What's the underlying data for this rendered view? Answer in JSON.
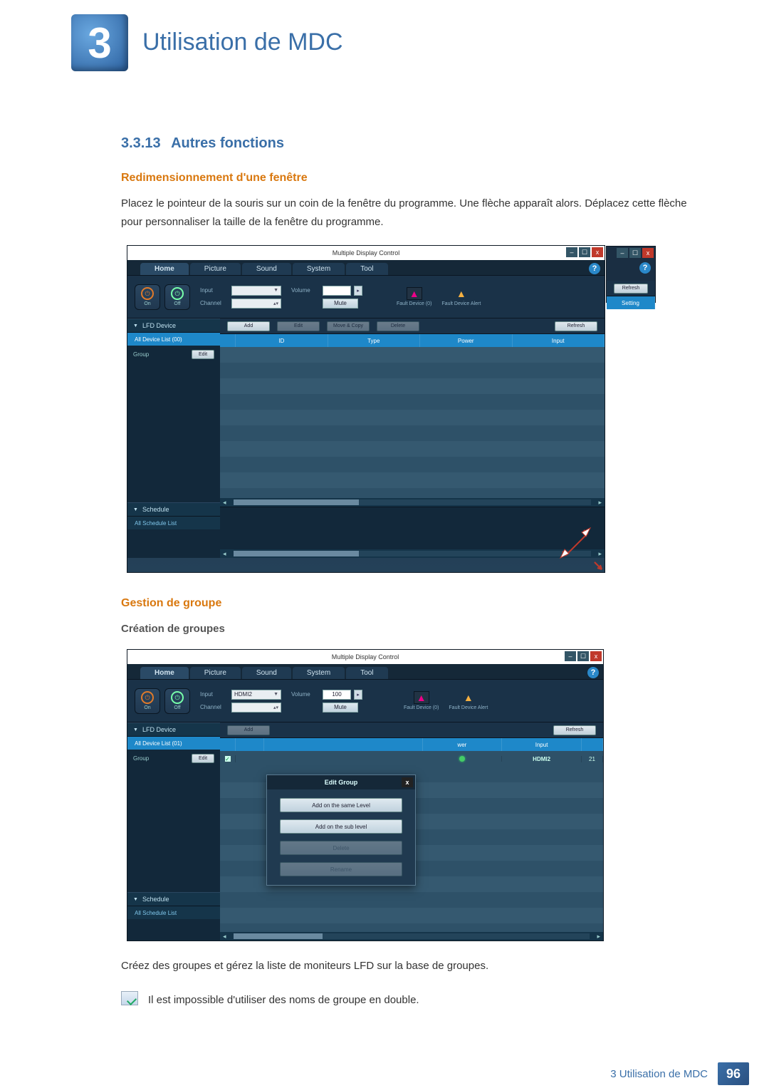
{
  "chapter": {
    "number": "3",
    "title": "Utilisation de MDC"
  },
  "section": {
    "number": "3.3.13",
    "title": "Autres fonctions"
  },
  "resize": {
    "heading": "Redimensionnement d'une fenêtre",
    "para": "Placez le pointeur de la souris sur un coin de la fenêtre du programme. Une flèche apparaît alors. Déplacez cette flèche pour personnaliser la taille de la fenêtre du programme."
  },
  "group": {
    "heading": "Gestion de groupe",
    "sub": "Création de groupes",
    "para": "Créez des groupes et gérez la liste de moniteurs LFD sur la base de groupes.",
    "note": "Il est impossible d'utiliser des noms de groupe en double."
  },
  "app": {
    "title": "Multiple Display Control",
    "help": "?",
    "win": {
      "min": "–",
      "max": "☐",
      "close": "x"
    },
    "tabs": {
      "home": "Home",
      "picture": "Picture",
      "sound": "Sound",
      "system": "System",
      "tool": "Tool"
    },
    "power": {
      "on": "On",
      "off": "Off"
    },
    "input": {
      "label": "Input",
      "value": "HDMI2"
    },
    "channel": {
      "label": "Channel"
    },
    "volume": {
      "label": "Volume",
      "value": "100",
      "mute": "Mute"
    },
    "fault": {
      "device": "Fault Device (0)",
      "alert": "Fault Device Alert"
    },
    "side": {
      "lfd": "LFD Device",
      "all0": "All Device List (00)",
      "all1": "All Device List (01)",
      "group": "Group",
      "edit": "Edit",
      "schedule": "Schedule",
      "allSchedule": "All Schedule List"
    },
    "toolbar": {
      "add": "Add",
      "edit": "Edit",
      "movecopy": "Move & Copy",
      "delete": "Delete",
      "refresh": "Refresh"
    },
    "cols": {
      "id": "ID",
      "type": "Type",
      "power": "Power",
      "input": "Input",
      "setting": "Setting"
    },
    "popup": {
      "title": "Edit Group",
      "same": "Add on the same Level",
      "sub": "Add on the sub level",
      "delete": "Delete",
      "rename": "Rename",
      "close": "x"
    },
    "device": {
      "input": "HDMI2",
      "id": "21",
      "pwr": "wer"
    }
  },
  "footer": {
    "text": "3 Utilisation de MDC",
    "page": "96"
  }
}
